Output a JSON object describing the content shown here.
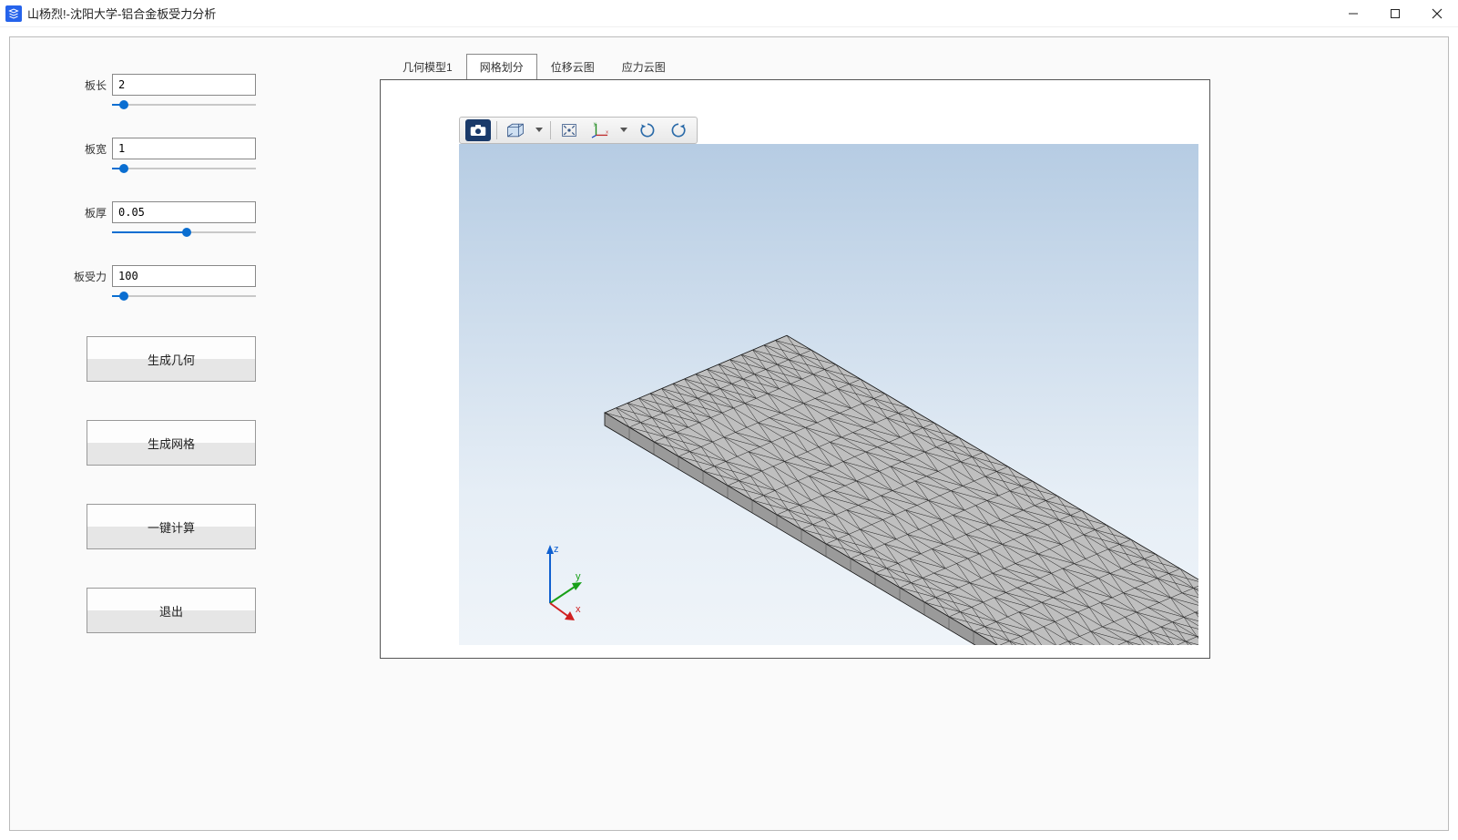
{
  "window": {
    "title": "山杨烈!-沈阳大学-铝合金板受力分析"
  },
  "params": {
    "length": {
      "label": "板长",
      "value": "2",
      "slider_pct": 8
    },
    "width": {
      "label": "板宽",
      "value": "1",
      "slider_pct": 8
    },
    "thick": {
      "label": "板厚",
      "value": "0.05",
      "slider_pct": 52
    },
    "force": {
      "label": "板受力",
      "value": "100",
      "slider_pct": 8
    }
  },
  "buttons": {
    "gen_geom": "生成几何",
    "gen_mesh": "生成网格",
    "calc": "一键计算",
    "exit": "退出"
  },
  "tabs": {
    "geom": "几何模型1",
    "mesh": "网格划分",
    "disp": "位移云图",
    "stress": "应力云图",
    "active": "mesh"
  },
  "toolbar_icons": {
    "camera": "camera-icon",
    "box": "boundingbox-icon",
    "fit": "fit-view-icon",
    "axes": "axes-icon",
    "rot_ccw": "rotate-ccw-icon",
    "rot_cw": "rotate-cw-icon"
  },
  "triad": {
    "x": "x",
    "y": "y",
    "z": "z"
  }
}
